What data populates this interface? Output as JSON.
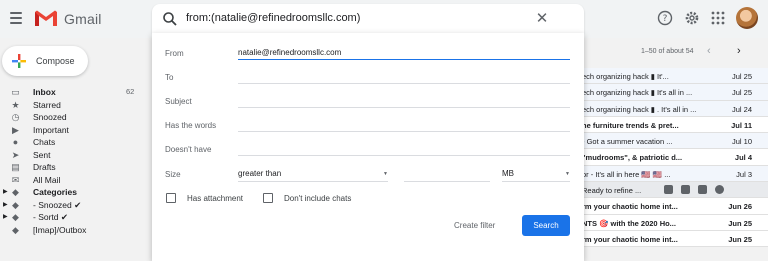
{
  "header": {
    "app_name": "Gmail",
    "search_query": "from:(natalie@refinedroomsllc.com)"
  },
  "sidebar": {
    "compose_label": "Compose",
    "items": [
      {
        "label": "Inbox",
        "count": "62",
        "icon": "inbox-icon",
        "bold": true
      },
      {
        "label": "Starred",
        "count": "",
        "icon": "star-icon"
      },
      {
        "label": "Snoozed",
        "count": "",
        "icon": "clock-icon"
      },
      {
        "label": "Important",
        "count": "",
        "icon": "important-icon"
      },
      {
        "label": "Chats",
        "count": "",
        "icon": "chat-icon"
      },
      {
        "label": "Sent",
        "count": "",
        "icon": "send-icon"
      },
      {
        "label": "Drafts",
        "count": "",
        "icon": "draft-icon"
      },
      {
        "label": "All Mail",
        "count": "",
        "icon": "mail-icon"
      },
      {
        "label": "Categories",
        "count": "",
        "icon": "label-icon",
        "bold": true
      },
      {
        "label": "- Snoozed ✔",
        "count": "",
        "icon": "label-icon"
      },
      {
        "label": "- Sortd ✔",
        "count": "",
        "icon": "label-icon"
      },
      {
        "label": "[Imap]/Outbox",
        "count": "",
        "icon": "label-icon"
      }
    ]
  },
  "list": {
    "pager": "1–50 of about 54",
    "rows": [
      {
        "subject": "ech organizing hack ▮ It'...",
        "date": "Jul 25",
        "unread": false
      },
      {
        "subject": "ech organizing hack ▮ It's all in ...",
        "date": "Jul 25",
        "unread": false
      },
      {
        "subject": "ech organizing hack ▮ . It's all in ...",
        "date": "Jul 24",
        "unread": false
      },
      {
        "subject": "he furniture trends & pret...",
        "date": "Jul 11",
        "unread": true
      },
      {
        "subject": "- Got a summer vacation ...",
        "date": "Jul 10",
        "unread": false
      },
      {
        "subject": "\"mudrooms\", & patriotic d...",
        "date": "Jul 4",
        "unread": true
      },
      {
        "subject": "or - It's all in here 🇺🇸 🇺🇸 ...",
        "date": "Jul 3",
        "unread": false
      },
      {
        "subject": "Ready to refine ...",
        "date": "",
        "unread": false,
        "hover": true
      },
      {
        "subject": "rm your chaotic home int...",
        "date": "Jun 26",
        "unread": true
      },
      {
        "subject": "NTS 🎯 with the 2020 Ho...",
        "date": "Jun 25",
        "unread": true
      },
      {
        "subject": "rm your chaotic home int...",
        "date": "Jun 25",
        "unread": true
      }
    ]
  },
  "advanced_search": {
    "from_label": "From",
    "from_value": "natalie@refinedroomsllc.com",
    "to_label": "To",
    "subject_label": "Subject",
    "has_words_label": "Has the words",
    "doesnt_have_label": "Doesn't have",
    "size_label": "Size",
    "size_operator": "greater than",
    "size_unit": "MB",
    "has_attachment_label": "Has attachment",
    "dont_include_chats_label": "Don't include chats",
    "create_filter_label": "Create filter",
    "search_label": "Search"
  },
  "colors": {
    "accent": "#1a73e8",
    "gmail_red": "#ea4335"
  }
}
